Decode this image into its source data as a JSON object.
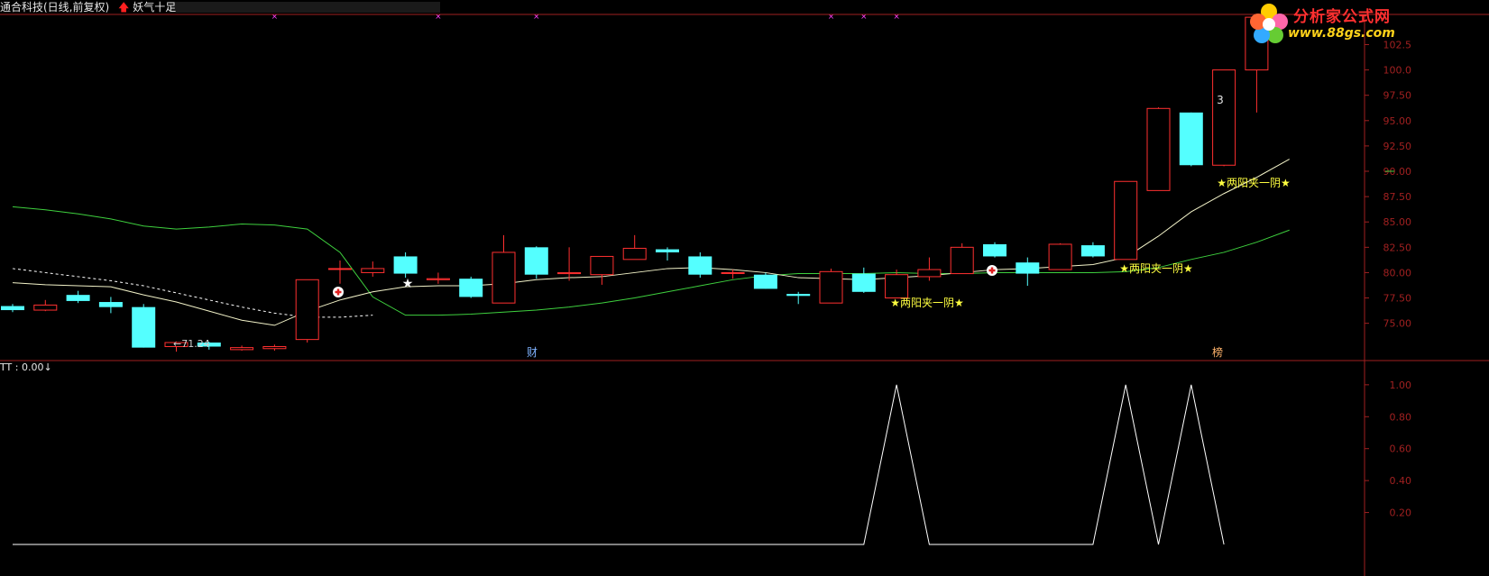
{
  "header": {
    "stock_name": "通合科技(日线,前复权)",
    "formula_name": "妖气十足"
  },
  "logo": {
    "title": "分析家公式网",
    "url": "www.88gs.com"
  },
  "colors": {
    "up": "#ff3030",
    "down": "#54ffff",
    "ma_short": "#f2f2c8",
    "ma_mid": "#ffffff",
    "ma_long": "#3ed03e",
    "axis": "#a02020",
    "label": "#ffff40",
    "marker": "#ff40ff"
  },
  "chart_data": [
    {
      "type": "candlestick",
      "panel": "main",
      "ylim": [
        71.5,
        105.3
      ],
      "yticks": [
        "102.5",
        "100.0",
        "97.50",
        "95.00",
        "92.50",
        "90.00",
        "87.50",
        "85.00",
        "82.50",
        "80.00",
        "77.50",
        "75.00"
      ],
      "candles": [
        {
          "o": 76.7,
          "c": 76.3,
          "h": 76.9,
          "l": 76.1
        },
        {
          "o": 76.3,
          "c": 76.8,
          "h": 77.3,
          "l": 76.2
        },
        {
          "o": 77.8,
          "c": 77.2,
          "h": 78.2,
          "l": 77.0
        },
        {
          "o": 77.1,
          "c": 76.6,
          "h": 77.6,
          "l": 76.0
        },
        {
          "o": 76.6,
          "c": 72.6,
          "h": 76.9,
          "l": 72.6
        },
        {
          "o": 72.7,
          "c": 73.1,
          "h": 73.2,
          "l": 72.2
        },
        {
          "o": 73.1,
          "c": 72.7,
          "h": 73.2,
          "l": 72.4
        },
        {
          "o": 72.4,
          "c": 72.6,
          "h": 72.8,
          "l": 72.3
        },
        {
          "o": 72.5,
          "c": 72.7,
          "h": 72.9,
          "l": 72.3
        },
        {
          "o": 73.4,
          "c": 79.3,
          "h": 79.3,
          "l": 73.1
        },
        {
          "o": 80.4,
          "c": 80.4,
          "h": 81.2,
          "l": 78.9
        },
        {
          "o": 80.0,
          "c": 80.4,
          "h": 81.1,
          "l": 79.6
        },
        {
          "o": 81.6,
          "c": 79.9,
          "h": 82.0,
          "l": 79.5
        },
        {
          "o": 79.3,
          "c": 79.4,
          "h": 80.0,
          "l": 78.9
        },
        {
          "o": 79.4,
          "c": 77.6,
          "h": 79.6,
          "l": 77.5
        },
        {
          "o": 77.0,
          "c": 82.0,
          "h": 83.7,
          "l": 77.0
        },
        {
          "o": 82.5,
          "c": 79.8,
          "h": 82.6,
          "l": 79.4
        },
        {
          "o": 79.9,
          "c": 80.0,
          "h": 82.5,
          "l": 79.2
        },
        {
          "o": 79.8,
          "c": 81.6,
          "h": 81.6,
          "l": 78.8
        },
        {
          "o": 81.3,
          "c": 82.4,
          "h": 83.7,
          "l": 81.3
        },
        {
          "o": 82.3,
          "c": 82.0,
          "h": 82.5,
          "l": 81.2
        },
        {
          "o": 81.6,
          "c": 79.8,
          "h": 82.0,
          "l": 79.5
        },
        {
          "o": 80.0,
          "c": 80.0,
          "h": 80.3,
          "l": 79.4
        },
        {
          "o": 79.8,
          "c": 78.4,
          "h": 80.0,
          "l": 78.4
        },
        {
          "o": 77.9,
          "c": 77.7,
          "h": 78.1,
          "l": 76.9
        },
        {
          "o": 77.0,
          "c": 80.1,
          "h": 80.4,
          "l": 77.0
        },
        {
          "o": 79.9,
          "c": 78.1,
          "h": 80.5,
          "l": 78.0
        },
        {
          "o": 77.5,
          "c": 79.8,
          "h": 80.3,
          "l": 77.5
        },
        {
          "o": 79.6,
          "c": 80.3,
          "h": 81.5,
          "l": 79.2
        },
        {
          "o": 79.9,
          "c": 82.5,
          "h": 82.9,
          "l": 79.9
        },
        {
          "o": 82.8,
          "c": 81.6,
          "h": 83.0,
          "l": 81.5
        },
        {
          "o": 81.0,
          "c": 79.9,
          "h": 81.5,
          "l": 78.7
        },
        {
          "o": 80.3,
          "c": 82.8,
          "h": 82.9,
          "l": 80.3
        },
        {
          "o": 82.7,
          "c": 81.6,
          "h": 83.0,
          "l": 81.5
        },
        {
          "o": 81.3,
          "c": 89.0,
          "h": 89.0,
          "l": 81.3
        },
        {
          "o": 88.1,
          "c": 96.2,
          "h": 96.3,
          "l": 88.1
        },
        {
          "o": 95.8,
          "c": 90.6,
          "h": 95.8,
          "l": 90.5
        },
        {
          "o": 90.6,
          "c": 100.0,
          "h": 100.0,
          "l": 90.5
        },
        {
          "o": 100.0,
          "c": 105.2,
          "h": 105.3,
          "l": 95.8
        }
      ],
      "ma_short": [
        79.0,
        78.8,
        78.7,
        78.6,
        77.8,
        77.1,
        76.2,
        75.3,
        74.8,
        76.2,
        77.3,
        78.1,
        78.6,
        78.7,
        78.7,
        78.9,
        79.3,
        79.5,
        79.6,
        80.0,
        80.4,
        80.5,
        80.3,
        80.0,
        79.5,
        79.4,
        79.3,
        79.5,
        79.7,
        80.0,
        80.3,
        80.4,
        80.6,
        80.8,
        81.5,
        83.6,
        86.0,
        87.8,
        89.4,
        91.2
      ],
      "ma_mid": [
        80.4,
        80.0,
        79.6,
        79.2,
        78.7,
        78.0,
        77.3,
        76.6,
        76.0,
        75.6,
        75.6,
        75.8
      ],
      "ma_long": [
        86.5,
        86.2,
        85.8,
        85.3,
        84.6,
        84.3,
        84.5,
        84.8,
        84.7,
        84.3,
        82.0,
        77.6,
        75.8,
        75.8,
        75.9,
        76.1,
        76.3,
        76.6,
        77.0,
        77.5,
        78.1,
        78.7,
        79.3,
        79.7,
        79.9,
        79.9,
        79.9,
        80.0,
        79.9,
        79.9,
        80.0,
        80.0,
        80.0,
        80.0,
        80.1,
        80.5,
        81.3,
        82.0,
        83.0,
        84.2
      ]
    },
    {
      "type": "line",
      "panel": "indicator",
      "name": "TT",
      "value_label": "TT  : 0.00",
      "ylim": [
        0.0,
        1.05
      ],
      "yticks": [
        "1.00",
        "0.80",
        "0.60",
        "0.40",
        "0.20"
      ],
      "values": [
        0,
        0,
        0,
        0,
        0,
        0,
        0,
        0,
        0,
        0,
        0,
        0,
        0,
        0,
        0,
        0,
        0,
        0,
        0,
        0,
        0,
        0,
        0,
        0,
        0,
        0,
        0,
        1,
        0,
        0,
        0,
        0,
        0,
        0,
        1,
        0,
        1,
        0
      ]
    }
  ],
  "annotations": {
    "low_label": "←71.24",
    "pattern_label": "★两阳夹一阴★",
    "event_cai": "财",
    "event_bang": "榜",
    "count_label": "3"
  }
}
